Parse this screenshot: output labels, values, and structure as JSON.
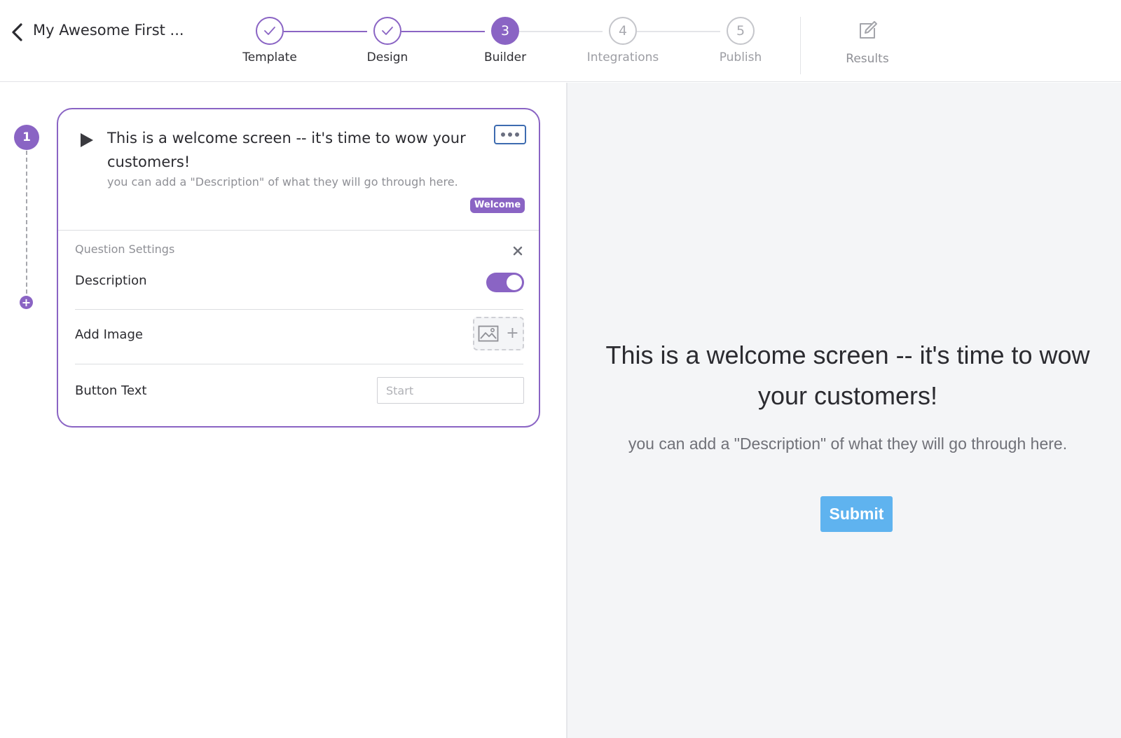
{
  "header": {
    "project_title": "My Awesome First ...",
    "steps": [
      {
        "number": "1",
        "label": "Template",
        "state": "done"
      },
      {
        "number": "2",
        "label": "Design",
        "state": "done"
      },
      {
        "number": "3",
        "label": "Builder",
        "state": "active"
      },
      {
        "number": "4",
        "label": "Integrations",
        "state": "todo"
      },
      {
        "number": "5",
        "label": "Publish",
        "state": "todo"
      }
    ],
    "results_label": "Results"
  },
  "builder": {
    "step_number": "1",
    "card": {
      "title": "This is a welcome screen -- it's time to wow your customers!",
      "description": "you can add a \"Description\" of what they will go through here.",
      "badge": "Welcome"
    },
    "settings": {
      "title": "Question Settings",
      "description_label": "Description",
      "description_enabled": true,
      "add_image_label": "Add Image",
      "button_text_label": "Button Text",
      "button_text_placeholder": "Start",
      "button_text_value": ""
    }
  },
  "preview": {
    "title": "This is a welcome screen -- it's time to wow your customers!",
    "description": "you can add a \"Description\" of what they will go through here.",
    "submit_label": "Submit"
  },
  "colors": {
    "accent": "#8a64c4",
    "submit": "#5fb3ef",
    "preview_bg": "#f4f5f7"
  }
}
